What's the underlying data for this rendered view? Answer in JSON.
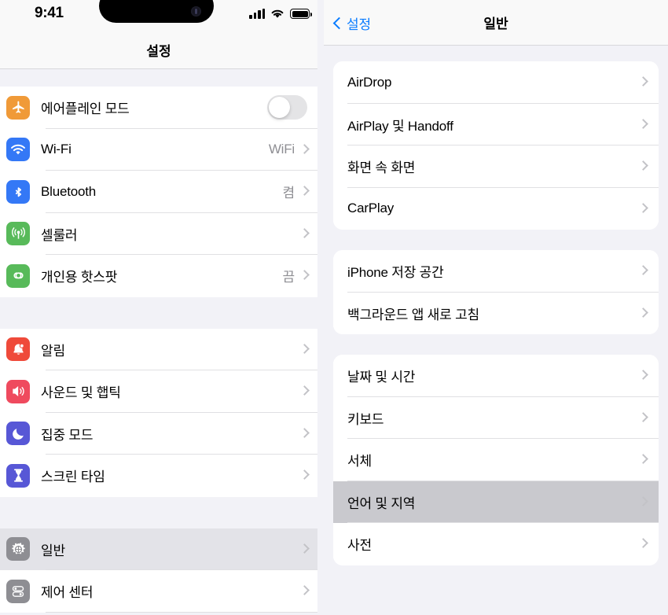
{
  "status_bar": {
    "time": "9:41",
    "icons": [
      "cellular-signal-icon",
      "wifi-icon",
      "battery-icon"
    ]
  },
  "left_pane": {
    "header_title": "설정",
    "groups": [
      {
        "rows": [
          {
            "icon": "airplane-icon",
            "icon_color": "#f09a38",
            "label": "에어플레인 모드",
            "control": "toggle",
            "toggle_on": false
          },
          {
            "icon": "wifi-icon",
            "icon_color": "#3478f6",
            "label": "Wi-Fi",
            "value": "WiFi",
            "control": "chevron"
          },
          {
            "icon": "bluetooth-icon",
            "icon_color": "#3478f6",
            "label": "Bluetooth",
            "value": "켬",
            "control": "chevron"
          },
          {
            "icon": "cellular-icon",
            "icon_color": "#58ba5a",
            "label": "셀룰러",
            "value": "",
            "control": "chevron"
          },
          {
            "icon": "hotspot-icon",
            "icon_color": "#58ba5a",
            "label": "개인용 핫스팟",
            "value": "끔",
            "control": "chevron"
          }
        ]
      },
      {
        "rows": [
          {
            "icon": "bell-icon",
            "icon_color": "#ef4a3a",
            "label": "알림",
            "value": "",
            "control": "chevron"
          },
          {
            "icon": "speaker-icon",
            "icon_color": "#ef4a5e",
            "label": "사운드 및 햅틱",
            "value": "",
            "control": "chevron"
          },
          {
            "icon": "moon-icon",
            "icon_color": "#5757d6",
            "label": "집중 모드",
            "value": "",
            "control": "chevron"
          },
          {
            "icon": "hourglass-icon",
            "icon_color": "#5757d6",
            "label": "스크린 타임",
            "value": "",
            "control": "chevron"
          }
        ]
      },
      {
        "rows": [
          {
            "icon": "gear-icon",
            "icon_color": "#8e8e93",
            "label": "일반",
            "value": "",
            "control": "chevron",
            "selected": true
          },
          {
            "icon": "control-center-icon",
            "icon_color": "#8e8e93",
            "label": "제어 센터",
            "value": "",
            "control": "chevron"
          }
        ]
      }
    ]
  },
  "right_pane": {
    "back_label": "설정",
    "title": "일반",
    "groups": [
      {
        "rows": [
          {
            "label": "AirDrop"
          },
          {
            "label": "AirPlay 및 Handoff"
          },
          {
            "label": "화면 속 화면"
          },
          {
            "label": "CarPlay"
          }
        ]
      },
      {
        "rows": [
          {
            "label": "iPhone 저장 공간"
          },
          {
            "label": "백그라운드 앱 새로 고침"
          }
        ]
      },
      {
        "rows": [
          {
            "label": "날짜 및 시간"
          },
          {
            "label": "키보드"
          },
          {
            "label": "서체"
          },
          {
            "label": "언어 및 지역",
            "selected": true
          },
          {
            "label": "사전"
          }
        ]
      }
    ]
  },
  "colors": {
    "accent_blue": "#0a7cff",
    "group_background": "#f2f2f7",
    "row_background": "#ffffff",
    "left_selected": "#e3e3e8",
    "right_selected": "#c9c9ce",
    "secondary_text": "#8e8e93",
    "separator": "#e0e0e3"
  }
}
